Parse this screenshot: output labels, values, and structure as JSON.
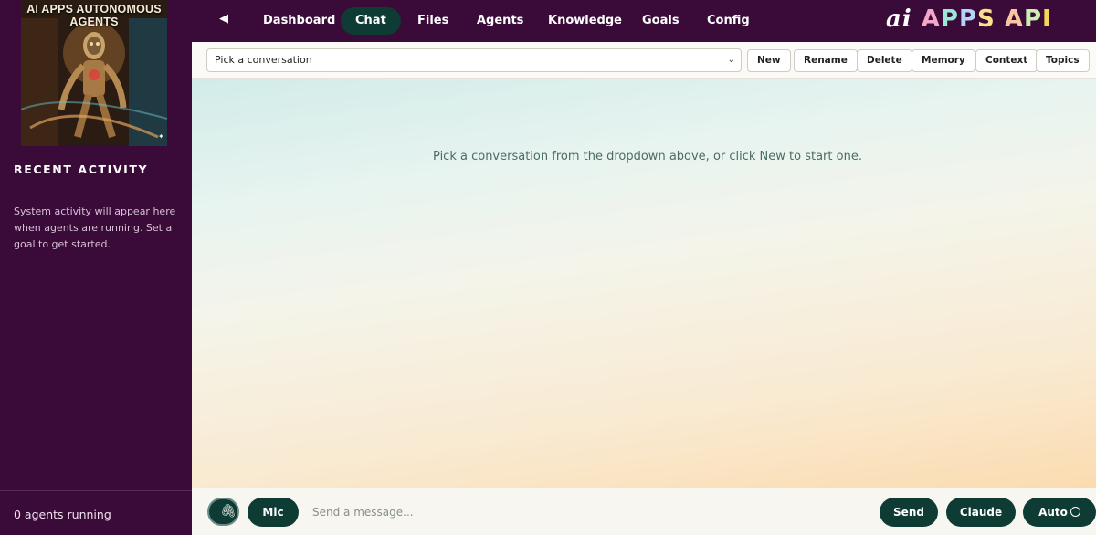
{
  "sidebar": {
    "logo_text": "AI APPS AUTONOMOUS AGENTS",
    "recent_title": "RECENT ACTIVITY",
    "recent_text": "System activity will appear here when agents are running. Set a goal to get started.",
    "agents_running": "0 agents running"
  },
  "nav": {
    "back_icon": "◀",
    "items": [
      {
        "label": "Dashboard"
      },
      {
        "label": "Chat",
        "active": true
      },
      {
        "label": "Files"
      },
      {
        "label": "Agents"
      },
      {
        "label": "Knowledge"
      },
      {
        "label": "Goals"
      },
      {
        "label": "Config"
      }
    ],
    "brand": {
      "ai": "ai",
      "apps": "APPS",
      "api": "API"
    }
  },
  "toolbar": {
    "select_value": "Pick a conversation",
    "buttons": [
      {
        "label": "New"
      },
      {
        "label": "Rename"
      },
      {
        "label": "Delete"
      },
      {
        "label": "Memory"
      },
      {
        "label": "Context"
      },
      {
        "label": "Topics"
      }
    ]
  },
  "chat": {
    "empty_message": "Pick a conversation from the dropdown above, or click New to start one."
  },
  "composer": {
    "attach_icon": "paperclip-icon",
    "mic_label": "Mic",
    "placeholder": "Send a message...",
    "send_label": "Send",
    "model_label": "Claude",
    "auto_label": "Auto"
  },
  "colors": {
    "sidebar_bg": "#3a0a39",
    "accent_dark": "#0e3b33",
    "text_muted": "#4d6b66"
  }
}
